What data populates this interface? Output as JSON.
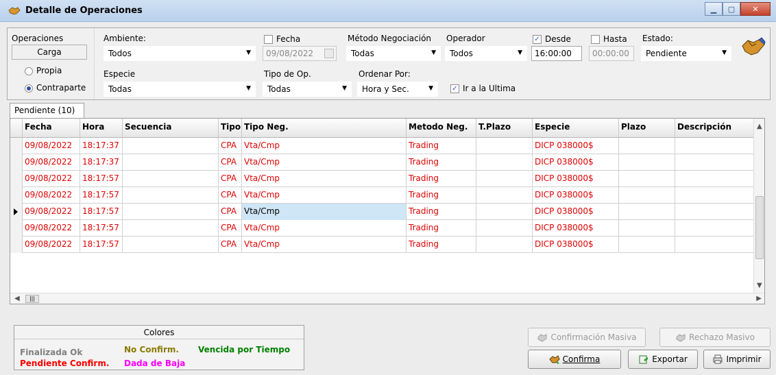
{
  "window": {
    "title": "Detalle de Operaciones"
  },
  "filters": {
    "operaciones_label": "Operaciones",
    "carga_label": "Carga",
    "propia_label": "Propia",
    "contraparte_label": "Contraparte",
    "selected_radio": "Contraparte",
    "ambiente_label": "Ambiente:",
    "ambiente_value": "Todos",
    "especie_label": "Especie",
    "especie_value": "Todas",
    "fecha_label": "Fecha",
    "fecha_checked": false,
    "fecha_value": "09/08/2022",
    "tipo_op_label": "Tipo de Op.",
    "tipo_op_value": "Todas",
    "metodo_label": "Método Negociación",
    "metodo_value": "Todas",
    "ordenar_label": "Ordenar Por:",
    "ordenar_value": "Hora y Sec.",
    "operador_label": "Operador",
    "operador_value": "Todos",
    "ir_ultima_label": "Ir a la Ultima",
    "ir_ultima_checked": true,
    "desde_label": "Desde",
    "desde_checked": true,
    "desde_value": "16:00:00",
    "hasta_label": "Hasta",
    "hasta_checked": false,
    "hasta_value": "00:00:00",
    "estado_label": "Estado:",
    "estado_value": "Pendiente"
  },
  "tab": {
    "label": "Pendiente (10)"
  },
  "grid": {
    "columns": [
      "Fecha",
      "Hora",
      "Secuencia",
      "Tipo",
      "Tipo Neg.",
      "Metodo Neg.",
      "T.Plazo",
      "Especie",
      "Plazo",
      "Descripción"
    ],
    "rows": [
      [
        "09/08/2022",
        "18:17:37",
        "",
        "CPA",
        "Vta/Cmp",
        "Trading",
        "",
        "DICP  038000$",
        "",
        ""
      ],
      [
        "09/08/2022",
        "18:17:37",
        "",
        "CPA",
        "Vta/Cmp",
        "Trading",
        "",
        "DICP  038000$",
        "",
        ""
      ],
      [
        "09/08/2022",
        "18:17:57",
        "",
        "CPA",
        "Vta/Cmp",
        "Trading",
        "",
        "DICP  038000$",
        "",
        ""
      ],
      [
        "09/08/2022",
        "18:17:57",
        "",
        "CPA",
        "Vta/Cmp",
        "Trading",
        "",
        "DICP  038000$",
        "",
        ""
      ],
      [
        "09/08/2022",
        "18:17:57",
        "",
        "CPA",
        "Vta/Cmp",
        "Trading",
        "",
        "DICP  038000$",
        "",
        ""
      ],
      [
        "09/08/2022",
        "18:17:57",
        "",
        "CPA",
        "Vta/Cmp",
        "Trading",
        "",
        "DICP  038000$",
        "",
        ""
      ],
      [
        "09/08/2022",
        "18:17:57",
        "",
        "CPA",
        "Vta/Cmp",
        "Trading",
        "",
        "DICP  038000$",
        "",
        ""
      ]
    ],
    "current_row": 4,
    "row_color": "#e00000"
  },
  "legend": {
    "title": "Colores",
    "finalizada": "Finalizada Ok",
    "no_confirm": "No Confirm.",
    "vencida": "Vencida por Tiempo",
    "pendiente": "Pendiente Confirm.",
    "dada_baja": "Dada de Baja",
    "colors": {
      "finalizada": "#7f7f7f",
      "no_confirm": "#8a7a00",
      "vencida": "#008000",
      "pendiente": "#ff0000",
      "dada_baja": "#ff00ff"
    }
  },
  "buttons": {
    "confirmacion_masiva": "Confirmación Masiva",
    "rechazo_masivo": "Rechazo Masivo",
    "confirma": "Confirma",
    "exportar": "Exportar",
    "imprimir": "Imprimir"
  }
}
